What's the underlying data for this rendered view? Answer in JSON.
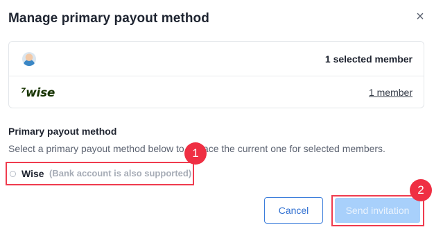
{
  "modal": {
    "title": "Manage primary payout method",
    "close_symbol": "×",
    "close_icon": "close-icon"
  },
  "summary": {
    "avatar_icon": "user-avatar",
    "selected_label": "1 selected member",
    "provider_logo_text": "⁷wise",
    "provider_member_link": "1 member"
  },
  "payout": {
    "section_title": "Primary payout method",
    "description": "Select a primary payout method below to replace the current one for selected members.",
    "option": {
      "name": "Wise",
      "note": "(Bank account is also supported)",
      "selected": false
    }
  },
  "actions": {
    "cancel_label": "Cancel",
    "send_label": "Send invitation"
  },
  "annotations": {
    "badge1": "1",
    "badge2": "2"
  },
  "colors": {
    "primary": "#2f6fd1",
    "disabled_primary": "#a8d0fb",
    "highlight": "#ef3b4e",
    "wise_brand": "#163300"
  }
}
